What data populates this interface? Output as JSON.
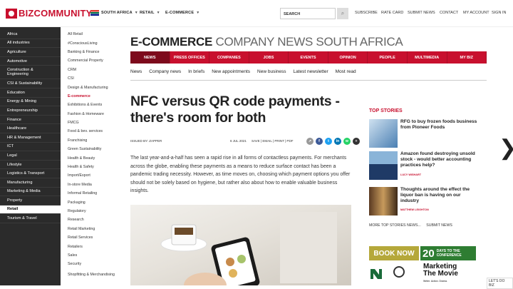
{
  "header": {
    "logo_text_biz": "BIZ",
    "logo_text_rest": "COMMUNITY",
    "region": "SOUTH AFRICA",
    "nav": [
      "RETAIL",
      "E-COMMERCE"
    ],
    "search_placeholder": "SEARCH",
    "links": [
      "SUBSCRIBE",
      "RATE CARD",
      "SUBMIT NEWS",
      "CONTACT",
      "MY ACCOUNT",
      "SIGN IN"
    ]
  },
  "sidebar": {
    "items": [
      "Africa",
      "All industries",
      "Agriculture",
      "Automotive",
      "Construction & Engineering",
      "CSI & Sustainability",
      "Education",
      "Energy & Mining",
      "Entrepreneurship",
      "Finance",
      "Healthcare",
      "HR & Management",
      "ICT",
      "Legal",
      "Lifestyle",
      "Logistics & Transport",
      "Manufacturing",
      "Marketing & Media",
      "Property",
      "Retail",
      "Tourism & Travel"
    ],
    "active": "Retail"
  },
  "subnav": {
    "items": [
      "All Retail",
      "#ConsciousLiving",
      "Banking & Finance",
      "Commercial Property",
      "CRM",
      "CSI",
      "Design & Manufacturing",
      "E-commerce",
      "Exhibitions & Events",
      "Fashion & Homeware",
      "FMCG",
      "Food & bev. services",
      "Franchising",
      "Green Sustainability",
      "Health & Beauty",
      "Health & Safety",
      "Import/Export",
      "In-store Media",
      "Informal Retailing",
      "Packaging",
      "Regulatory",
      "Research",
      "Retail Marketing",
      "Retail Services",
      "Retailers",
      "Sales",
      "Security",
      "Shopfitting & Merchandising"
    ],
    "active": "E-commerce"
  },
  "section": {
    "title_bold": "E-COMMERCE",
    "title_light": "COMPANY NEWS SOUTH AFRICA",
    "rednav": [
      "NEWS",
      "PRESS OFFICES",
      "COMPANIES",
      "JOBS",
      "EVENTS",
      "OPINION",
      "PEOPLE",
      "MULTIMEDIA",
      "MY BIZ"
    ],
    "rednav_active": "NEWS",
    "tabs": [
      "News",
      "Company news",
      "In briefs",
      "New appointments",
      "New business",
      "Latest newsletter",
      "Most read"
    ]
  },
  "article": {
    "headline": "NFC versus QR code payments - there's room for both",
    "issued": "ISSUED BY: ZAPPER",
    "date": "6 JUL 2021",
    "actions": "SAVE | EMAIL | PRINT | PDF",
    "body": "The last year-and-a-half has seen a rapid rise in all forms of contactless payments. For merchants across the globe, enabling these payments as a means to reduce surface contact has been a pandemic trading necessity. However, as time moves on, choosing which payment options you offer should not be solely based on hygiene, but rather also about how to enable valuable business insights."
  },
  "top_stories": {
    "title": "TOP STORIES",
    "items": [
      {
        "title": "RFG to buy frozen foods business from Pioneer Foods",
        "credit": ""
      },
      {
        "title": "Amazon found destroying unsold stock - would better accounting practices help?",
        "credit": "LUCY WISHART"
      },
      {
        "title": "Thoughts around the effect the liquor ban is having on our industry",
        "credit": "MATTHEW LEIGHTON"
      }
    ],
    "more": "MORE TOP STORIES NEWS...",
    "submit": "SUBMIT NEWS"
  },
  "ad": {
    "book": "BOOK NOW",
    "days_num": "20",
    "days_text_1": "DAYS TO THE",
    "days_text_2": "CONFERENCE",
    "brand_line1": "Marketing",
    "brand_line2": "The Movie",
    "tagline": "Writer. Action. Drama."
  },
  "lets_do": "LET'S DO BIZ",
  "colors": {
    "accent": "#c8102e",
    "sidebar": "#2b2b2b",
    "nav_active": "#7d0a1c"
  }
}
